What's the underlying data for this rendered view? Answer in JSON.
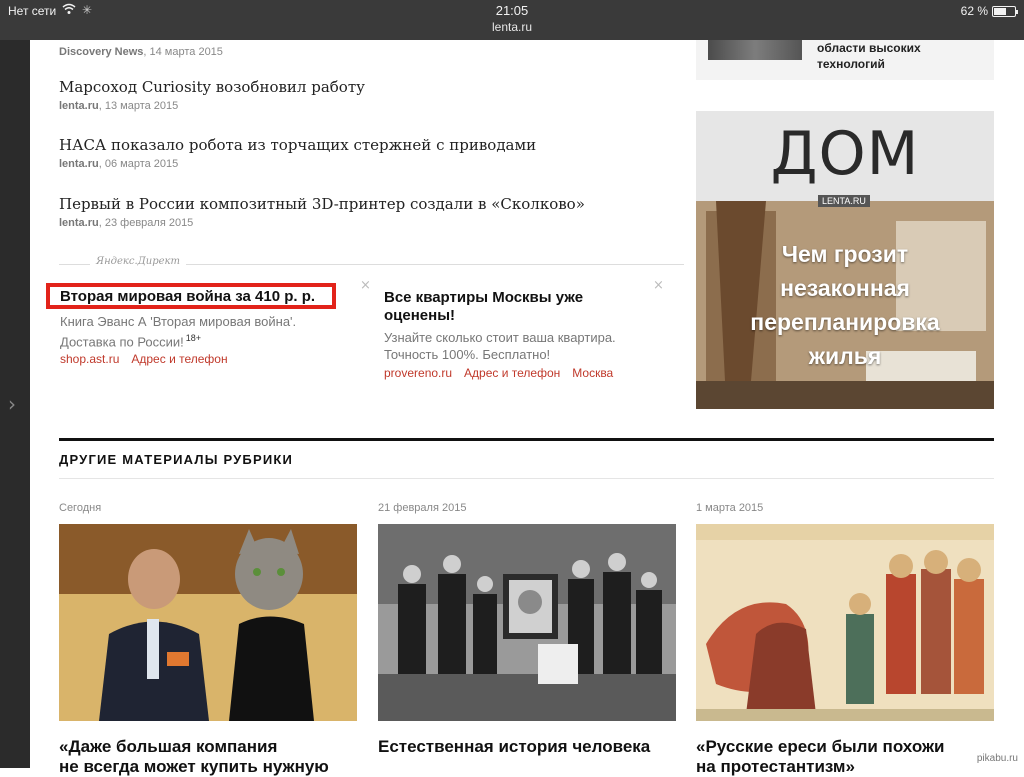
{
  "status_bar": {
    "carrier": "Нет сети",
    "time": "21:05",
    "url": "lenta.ru",
    "battery": "62 %",
    "battery_level": 0.62
  },
  "news_list": [
    {
      "title": "",
      "source": "Discovery News",
      "date": "14 марта 2015"
    },
    {
      "title": "Марсоход Curiosity возобновил работу",
      "source": "lenta.ru",
      "date": "13 марта 2015"
    },
    {
      "title": "НАСА показало робота из торчащих стержней с приводами",
      "source": "lenta.ru",
      "date": "06 марта 2015"
    },
    {
      "title": "Первый в России композитный 3D-принтер создали в «Сколково»",
      "source": "lenta.ru",
      "date": "23 февраля 2015"
    }
  ],
  "direct": {
    "label": "Яндекс.Директ",
    "ads": [
      {
        "title": "Вторая мировая война за 410 р. р.",
        "text_line1": "Книга Эванс А 'Вторая мировая война'.",
        "text_line2": "Доставка по России!",
        "age": "18+",
        "links": [
          "shop.ast.ru",
          "Адрес и телефон"
        ]
      },
      {
        "title_line1": "Все квартиры Москвы уже",
        "title_line2": "оценены!",
        "text_line1": "Узнайте сколько стоит ваша квартира.",
        "text_line2": "Точность 100%. Бесплатно!",
        "links": [
          "provereno.ru",
          "Адрес и телефон",
          "Москва"
        ]
      }
    ],
    "close": "×"
  },
  "right_column": {
    "top_card_line1": "области высоких",
    "top_card_line2": "технологий",
    "dom_ad": {
      "word": "ДОМ",
      "badge": "LENTA.RU",
      "text_line1": "Чем грозит",
      "text_line2": "незаконная",
      "text_line3": "перепланировка",
      "text_line4": "жилья"
    }
  },
  "other_materials": {
    "heading": "ДРУГИЕ МАТЕРИАЛЫ РУБРИКИ",
    "cards": [
      {
        "date": "Сегодня",
        "title_line1": "«Даже большая компания",
        "title_line2": "не всегда может купить нужную"
      },
      {
        "date": "21 февраля 2015",
        "title_line1": "Естественная история человека",
        "title_line2": ""
      },
      {
        "date": "1 марта 2015",
        "title_line1": "«Русские ереси были похожи",
        "title_line2": "на протестантизм»"
      }
    ]
  },
  "watermark": "pikabu.ru",
  "colors": {
    "highlight_box": "#e2231a",
    "ad_link": "#c0392b",
    "status_bar": "#3a3a3a"
  }
}
